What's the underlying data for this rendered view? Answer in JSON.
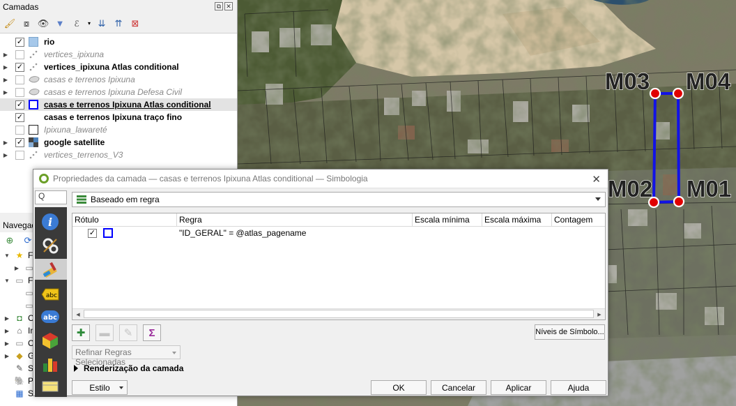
{
  "layers_panel": {
    "title": "Camadas",
    "layers": [
      {
        "name": "rio",
        "checked": true,
        "style": "bold",
        "symbol": "fill-lightblue",
        "expandable": false
      },
      {
        "name": "vertices_ipixuna",
        "checked": false,
        "style": "italic",
        "symbol": "points",
        "expandable": true
      },
      {
        "name": "vertices_ipixuna Atlas conditional",
        "checked": true,
        "style": "bold",
        "symbol": "points",
        "expandable": true
      },
      {
        "name": "casas e terrenos Ipixuna",
        "checked": false,
        "style": "italic",
        "symbol": "polygon-grey",
        "expandable": true
      },
      {
        "name": "casas e terrenos Ipixuna  Defesa Civil",
        "checked": false,
        "style": "italic",
        "symbol": "polygon-grey",
        "expandable": true
      },
      {
        "name": "casas e terrenos Ipixuna  Atlas conditional",
        "checked": true,
        "style": "bold-underline",
        "symbol": "square-blue",
        "expandable": false
      },
      {
        "name": "casas e terrenos Ipixuna  traço fino",
        "checked": true,
        "style": "bold",
        "symbol": "none",
        "expandable": false
      },
      {
        "name": "Ipixuna_lawareté",
        "checked": false,
        "style": "italic",
        "symbol": "square-black",
        "expandable": false
      },
      {
        "name": "google satellite",
        "checked": true,
        "style": "bold",
        "symbol": "raster",
        "expandable": true
      },
      {
        "name": "vertices_terrenos_V3",
        "checked": false,
        "style": "italic",
        "symbol": "points",
        "expandable": true
      }
    ]
  },
  "browser_panel": {
    "title": "Navegad",
    "items": [
      "Fa",
      "",
      "Fa",
      "",
      "",
      "C",
      "In",
      "C",
      "G",
      "Sp",
      "Po",
      "SAP HANA"
    ]
  },
  "dialog": {
    "title": "Propriedades da camada — casas e terrenos Ipixuna  Atlas conditional — Simbologia",
    "search_placeholder": "Q",
    "renderer": "Baseado em regra",
    "columns": [
      "Rótulo",
      "Regra",
      "Escala mínima",
      "Escala máxima",
      "Contagem"
    ],
    "rules": [
      {
        "label": "",
        "rule": "\"ID_GERAL\" = @atlas_pagename",
        "checked": true,
        "symbol_color": "#0000ff"
      }
    ],
    "symbol_levels_button": "Níveis de Símbolo...",
    "refine_rules": "Refinar Regras Selecionadas",
    "layer_rendering": "Renderização da camada",
    "style_button": "Estilo",
    "ok": "OK",
    "cancel": "Cancelar",
    "apply": "Aplicar",
    "help": "Ajuda"
  },
  "map": {
    "markers": [
      {
        "label": "M03"
      },
      {
        "label": "M04"
      },
      {
        "label": "M02"
      },
      {
        "label": "M01"
      }
    ],
    "outline_color": "#1212e6",
    "marker_color": "#e00000"
  }
}
